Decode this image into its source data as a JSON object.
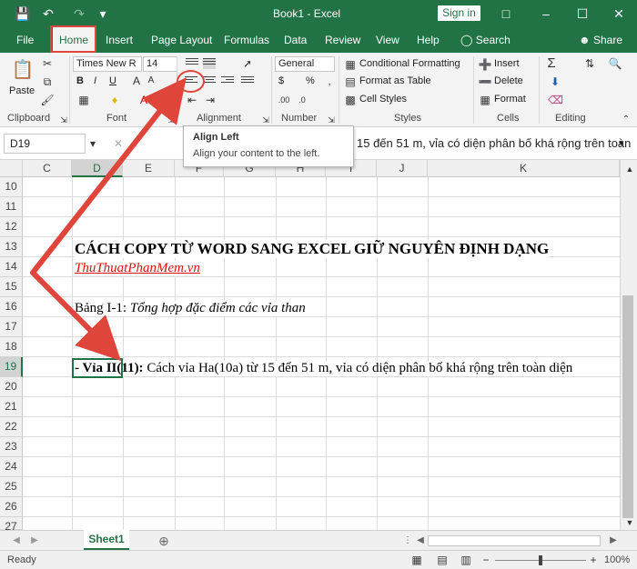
{
  "titlebar": {
    "title": "Book1 - Excel",
    "signin": "Sign in"
  },
  "tabs": [
    "File",
    "Home",
    "Insert",
    "Page Layout",
    "Formulas",
    "Data",
    "Review",
    "View",
    "Help"
  ],
  "search_label": "Search",
  "share_label": "Share",
  "ribbon": {
    "clipboard": {
      "paste": "Paste",
      "label": "Clipboard"
    },
    "font": {
      "name": "Times New R",
      "size": "14",
      "label": "Font",
      "bold": "B",
      "italic": "I",
      "underline": "U"
    },
    "alignment": {
      "label": "Alignment"
    },
    "number": {
      "format": "General",
      "label": "Number",
      "currency": "$",
      "percent": "%"
    },
    "styles": {
      "conditional": "Conditional Formatting",
      "table": "Format as Table",
      "cell_styles": "Cell Styles",
      "label": "Styles"
    },
    "cells": {
      "insert": "Insert",
      "delete": "Delete",
      "format": "Format",
      "label": "Cells"
    },
    "editing": {
      "label": "Editing"
    }
  },
  "formula_bar": {
    "name_box": "D19",
    "fx": "fx",
    "content": "15 đến 51 m, vỉa có diện phân bố khá rộng trên toàn"
  },
  "tooltip": {
    "title": "Align Left",
    "desc": "Align your content to the left."
  },
  "columns": [
    "C",
    "D",
    "E",
    "F",
    "G",
    "H",
    "I",
    "J",
    "K"
  ],
  "rows": [
    "10",
    "11",
    "12",
    "13",
    "14",
    "15",
    "16",
    "17",
    "18",
    "19",
    "20",
    "21",
    "22",
    "23",
    "24",
    "25",
    "26",
    "27"
  ],
  "cells": {
    "r13": "CÁCH COPY TỪ WORD SANG EXCEL GIỮ NGUYÊN ĐỊNH DẠNG",
    "r14": "ThuThuatPhanMem.vn",
    "r16_a": "Bảng I-1: ",
    "r16_b": "Tổng hợp đặc điểm các vỉa than",
    "r19_a": "- Vỉa II(11):",
    "r19_b": " Cách vỉa Ha(10a) từ 15 đến 51 m, vỉa có diện phân bố khá rộng trên toàn diện"
  },
  "sheet_tab": "Sheet1",
  "status": {
    "ready": "Ready",
    "zoom": "100%"
  },
  "colors": {
    "accent": "#217346",
    "annotation": "#e0453c"
  }
}
